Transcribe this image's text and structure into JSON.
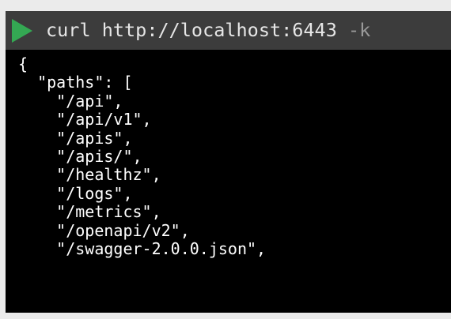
{
  "command": {
    "text": "curl http://localhost:6443",
    "flag": " -k"
  },
  "output_lines": [
    "{",
    "  \"paths\": [",
    "    \"/api\",",
    "    \"/api/v1\",",
    "    \"/apis\",",
    "    \"/apis/\",",
    "    \"/healthz\",",
    "    \"/logs\",",
    "    \"/metrics\",",
    "    \"/openapi/v2\",",
    "    \"/swagger-2.0.0.json\","
  ],
  "colors": {
    "background": "#ebebeb",
    "terminal": "#000000",
    "command_bar": "#3c3c3c",
    "play_icon": "#34a853",
    "command_text": "#e6e6e6",
    "flag_text": "#9a9a9a",
    "output_text": "#ffffff"
  },
  "icons": {
    "run": "play-icon"
  }
}
